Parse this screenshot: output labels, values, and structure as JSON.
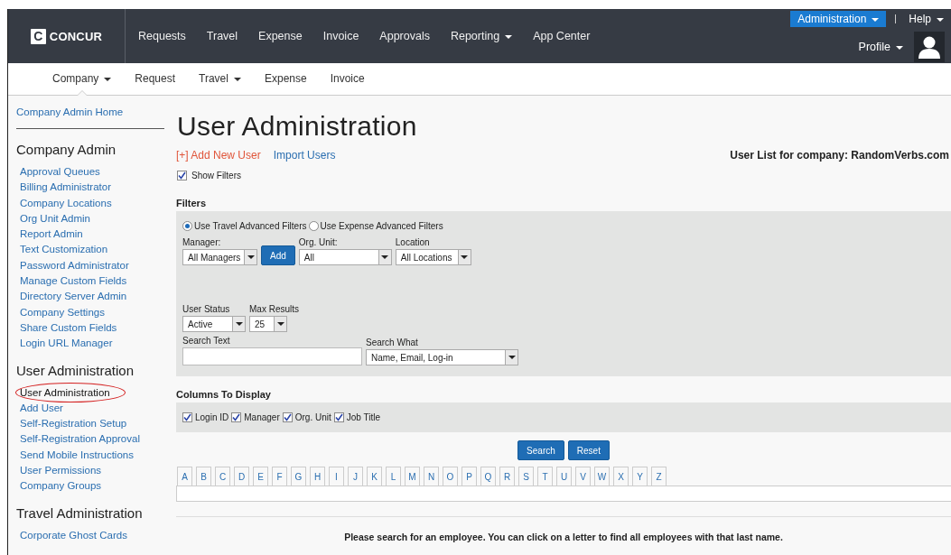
{
  "top_nav": {
    "logo_mark": "C",
    "logo": "CONCUR",
    "admin_menu": "Administration",
    "help_menu": "Help",
    "profile_menu": "Profile",
    "items": [
      {
        "label": "Requests",
        "dropdown": false
      },
      {
        "label": "Travel",
        "dropdown": false
      },
      {
        "label": "Expense",
        "dropdown": false
      },
      {
        "label": "Invoice",
        "dropdown": false
      },
      {
        "label": "Approvals",
        "dropdown": false
      },
      {
        "label": "Reporting",
        "dropdown": true
      },
      {
        "label": "App Center",
        "dropdown": false
      }
    ]
  },
  "sub_nav": {
    "items": [
      {
        "label": "Company",
        "dropdown": true,
        "selected": true
      },
      {
        "label": "Request",
        "dropdown": false,
        "selected": false
      },
      {
        "label": "Travel",
        "dropdown": true,
        "selected": false
      },
      {
        "label": "Expense",
        "dropdown": false,
        "selected": false
      },
      {
        "label": "Invoice",
        "dropdown": false,
        "selected": false
      }
    ]
  },
  "sidebar": {
    "home_link": "Company Admin Home",
    "sections": [
      {
        "heading": "Company Admin",
        "items": [
          {
            "label": "Approval Queues",
            "selected": false
          },
          {
            "label": "Billing Administrator",
            "selected": false
          },
          {
            "label": "Company Locations",
            "selected": false
          },
          {
            "label": "Org Unit Admin",
            "selected": false
          },
          {
            "label": "Report Admin",
            "selected": false
          },
          {
            "label": "Text Customization",
            "selected": false
          },
          {
            "label": "Password Administrator",
            "selected": false
          },
          {
            "label": "Manage Custom Fields",
            "selected": false
          },
          {
            "label": "Directory Server Admin",
            "selected": false
          },
          {
            "label": "Company Settings",
            "selected": false
          },
          {
            "label": "Share Custom Fields",
            "selected": false
          },
          {
            "label": "Login URL Manager",
            "selected": false
          }
        ]
      },
      {
        "heading": "User Administration",
        "items": [
          {
            "label": "User Administration",
            "selected": true
          },
          {
            "label": "Add User",
            "selected": false
          },
          {
            "label": "Self-Registration Setup",
            "selected": false
          },
          {
            "label": "Self-Registration Approval",
            "selected": false
          },
          {
            "label": "Send Mobile Instructions",
            "selected": false
          },
          {
            "label": "User Permissions",
            "selected": false
          },
          {
            "label": "Company Groups",
            "selected": false
          }
        ]
      },
      {
        "heading": "Travel Administration",
        "items": [
          {
            "label": "Corporate Ghost Cards",
            "selected": false
          }
        ]
      }
    ]
  },
  "main": {
    "title": "User Administration",
    "add_user_link": "[+] Add New User",
    "import_link": "Import Users",
    "company_label": "User List for company: RandomVerbs.com",
    "show_filters": {
      "label": "Show Filters",
      "checked": true
    },
    "filters": {
      "heading": "Filters",
      "radios": [
        {
          "label": "Use Travel Advanced Filters",
          "selected": true
        },
        {
          "label": "Use Expense Advanced Filters",
          "selected": false
        }
      ],
      "manager": {
        "label": "Manager:",
        "value": "All Managers"
      },
      "add_button": "Add",
      "org_unit": {
        "label": "Org. Unit:",
        "value": "All"
      },
      "location": {
        "label": "Location",
        "value": "All Locations"
      },
      "user_status": {
        "label": "User Status",
        "value": "Active"
      },
      "max_results": {
        "label": "Max Results",
        "value": "25"
      },
      "search_text": {
        "label": "Search Text"
      },
      "search_what": {
        "label": "Search What",
        "value": "Name, Email, Log-in"
      }
    },
    "columns": {
      "heading": "Columns To Display",
      "options": [
        {
          "label": "Login ID",
          "checked": true
        },
        {
          "label": "Manager",
          "checked": true
        },
        {
          "label": "Org. Unit",
          "checked": true
        },
        {
          "label": "Job Title",
          "checked": true
        }
      ]
    },
    "search_button": "Search",
    "reset_button": "Reset",
    "letters": [
      "A",
      "B",
      "C",
      "D",
      "E",
      "F",
      "G",
      "H",
      "I",
      "J",
      "K",
      "L",
      "M",
      "N",
      "O",
      "P",
      "Q",
      "R",
      "S",
      "T",
      "U",
      "V",
      "W",
      "X",
      "Y",
      "Z"
    ],
    "message": "Please search for an employee. You can click on a letter to find all employees with that last name."
  }
}
